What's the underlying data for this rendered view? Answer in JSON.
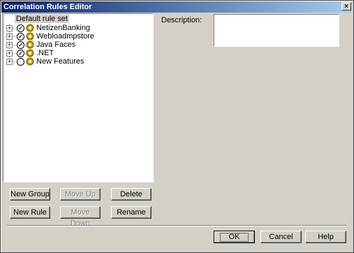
{
  "window": {
    "title": "Correlation Rules Editor",
    "close_glyph": "×"
  },
  "tree": {
    "root_label": "Default rule set",
    "items": [
      {
        "label": "NetizenBanking",
        "checked": true,
        "icon": "gear-icon"
      },
      {
        "label": "Webloadmpstore",
        "checked": true,
        "icon": "gear-icon"
      },
      {
        "label": "Java Faces",
        "checked": true,
        "icon": "gear-icon"
      },
      {
        "label": ".NET",
        "checked": true,
        "icon": "gear-icon"
      },
      {
        "label": "New Features",
        "checked": false,
        "icon": "gear-icon"
      }
    ],
    "expander_glyph": "+",
    "check_glyph": "✓"
  },
  "buttons": {
    "new_group": "New Group",
    "move_up": "Move Up",
    "delete": "Delete",
    "new_rule": "New Rule",
    "move_down": "Move Down",
    "rename": "Rename",
    "ok": "OK",
    "cancel": "Cancel",
    "help": "Help"
  },
  "description": {
    "label": "Description:",
    "value": ""
  },
  "colors": {
    "face": "#d4d0c8",
    "title_start": "#0a246a",
    "title_end": "#a6caf0",
    "gear": "#c8a000"
  }
}
